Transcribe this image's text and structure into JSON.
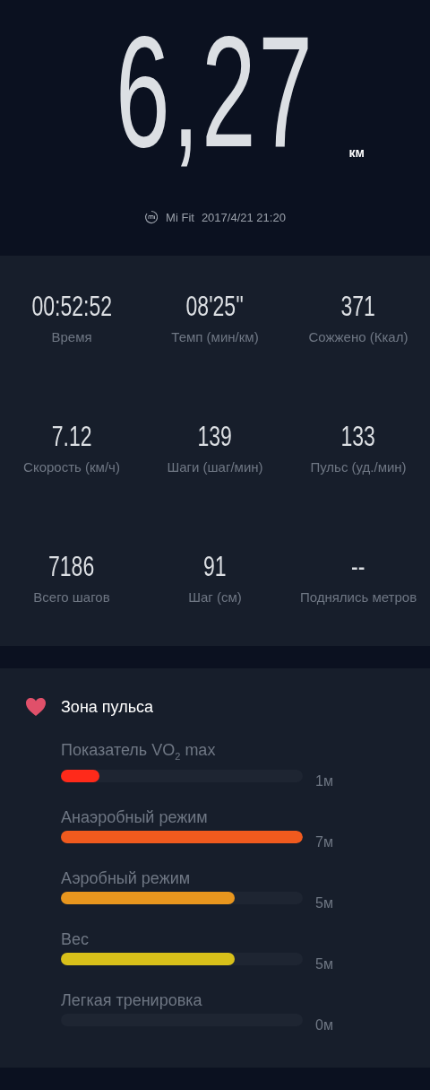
{
  "distance": {
    "value": "6,27",
    "unit": "км"
  },
  "source": {
    "app": "Mi Fit",
    "datetime": "2017/4/21 21:20"
  },
  "stats": [
    {
      "value": "00:52:52",
      "label": "Время"
    },
    {
      "value": "08'25''",
      "label": "Темп (мин/км)"
    },
    {
      "value": "371",
      "label": "Сожжено (Ккал)"
    },
    {
      "value": "7.12",
      "label": "Скорость (км/ч)"
    },
    {
      "value": "139",
      "label": "Шаги (шаг/мин)"
    },
    {
      "value": "133",
      "label": "Пульс (уд./мин)"
    },
    {
      "value": "7186",
      "label": "Всего шагов"
    },
    {
      "value": "91",
      "label": "Шаг (см)"
    },
    {
      "value": "--",
      "label": "Поднялись метров"
    }
  ],
  "heart_zones": {
    "title": "Зона пульса",
    "zones": [
      {
        "label": "Показатель VO$_{2}$ max",
        "level": 0.16,
        "color": "#ff2a1a",
        "time": "1м"
      },
      {
        "label": "Анаэробный режим",
        "level": 1.0,
        "color": "#f05a1e",
        "time": "7м"
      },
      {
        "label": "Аэробный режим",
        "level": 0.72,
        "color": "#e8961e",
        "time": "5м"
      },
      {
        "label": "Вес",
        "level": 0.72,
        "color": "#d8c01a",
        "time": "5м"
      },
      {
        "label": "Легкая тренировка",
        "time": "0м"
      }
    ]
  }
}
